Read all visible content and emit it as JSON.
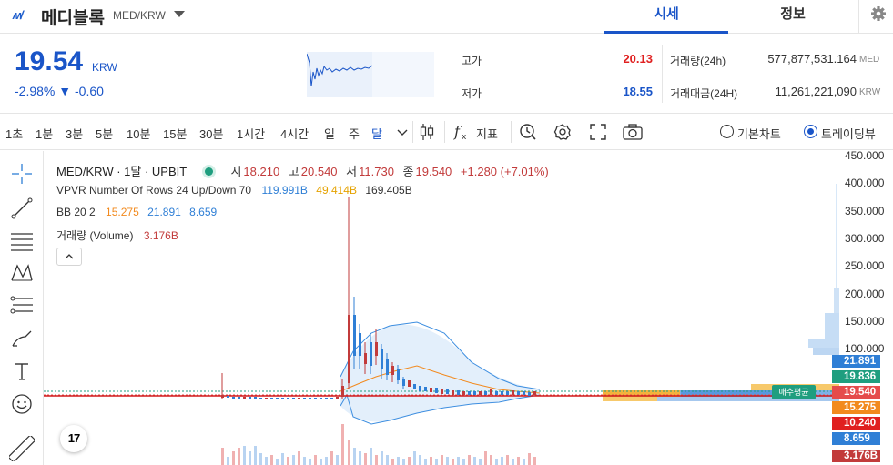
{
  "header": {
    "coin_name": "메디블록",
    "pair": "MED/KRW",
    "tabs": [
      {
        "label": "시세"
      },
      {
        "label": "정보"
      }
    ]
  },
  "price": {
    "current": "19.54",
    "unit": "KRW",
    "change": "-2.98% ▼ -0.60",
    "high_label": "고가",
    "high": "20.13",
    "low_label": "저가",
    "low": "18.55",
    "volume_label": "거래량(24h)",
    "volume": "577,877,531.164",
    "volume_unit": "MED",
    "amount_label": "거래대금(24H)",
    "amount": "11,261,221,090",
    "amount_unit": "KRW"
  },
  "toolbar": {
    "timeframes": [
      "1초",
      "1분",
      "3분",
      "5분",
      "10분",
      "15분",
      "30분",
      "1시간",
      "4시간",
      "일",
      "주",
      "달"
    ],
    "active_timeframe": "달",
    "indicator_label": "지표",
    "basic_chart_label": "기본차트",
    "trading_view_label": "트레이딩뷰"
  },
  "chart": {
    "symbol_line": "MED/KRW · 1달 · UPBIT",
    "ohlc": {
      "o_label": "시",
      "o": "18.210",
      "h_label": "고",
      "h": "20.540",
      "l_label": "저",
      "l": "11.730",
      "c_label": "종",
      "c": "19.540",
      "chg": "+1.280 (+7.01%)"
    },
    "vpvr": {
      "label": "VPVR Number Of Rows 24 Up/Down 70",
      "up": "119.991B",
      "down": "49.414B",
      "total": "169.405B"
    },
    "bb": {
      "label": "BB 20 2",
      "basis": "15.275",
      "upper": "21.891",
      "lower": "8.659"
    },
    "vol": {
      "label": "거래량 (Volume)",
      "value": "3.176B"
    },
    "y_axis": [
      "450.000",
      "400.000",
      "350.000",
      "300.000",
      "250.000",
      "200.000",
      "150.000",
      "100.000"
    ],
    "tags": [
      {
        "value": "21.891",
        "color": "#2f7fd6"
      },
      {
        "value": "19.836",
        "color": "#1f9e7f"
      },
      {
        "value": "19.540",
        "color": "#e54b4b"
      },
      {
        "value": "15.275",
        "color": "#f28a1e"
      },
      {
        "value": "10.240",
        "color": "#e02020"
      },
      {
        "value": "8.659",
        "color": "#2f7fd6"
      },
      {
        "value": "3.176B",
        "color": "#c23b3b"
      }
    ],
    "avg_tag": "매수평균",
    "tv_logo": "17"
  }
}
